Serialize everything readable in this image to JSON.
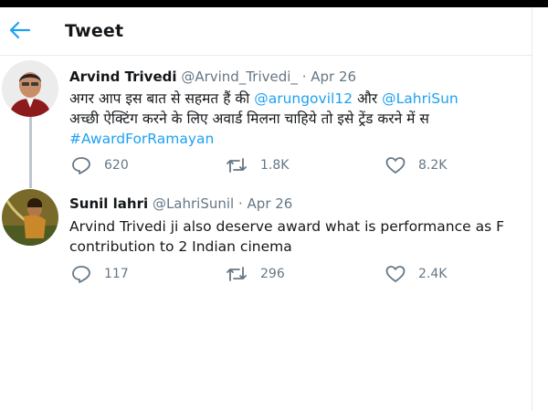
{
  "header": {
    "title": "Tweet",
    "back_icon": "arrow-left-icon"
  },
  "accent": "#1da1f2",
  "tweets": [
    {
      "name": "Arvind Trivedi",
      "handle": "@Arvind_Trivedi_",
      "sep": "·",
      "date": "Apr 26",
      "line1_text": "अगर आप इस बात से सहमत हैं की ",
      "mention1": "@arungovil12",
      "line1_and": " और ",
      "mention2": "@LahriSun",
      "line2": "अच्छी ऐक्टिंग करने के लिए अवार्ड मिलना चाहिये तो इसे ट्रेंड करने में स",
      "hashtag": "#AwardForRamayan",
      "replies": "620",
      "retweets": "1.8K",
      "likes": "8.2K"
    },
    {
      "name": "Sunil lahri",
      "handle": "@LahriSunil",
      "sep": "·",
      "date": "Apr 26",
      "line1": "Arvind Trivedi ji also deserve award what is performance as F",
      "line2": "contribution to 2 Indian cinema",
      "replies": "117",
      "retweets": "296",
      "likes": "2.4K"
    }
  ]
}
